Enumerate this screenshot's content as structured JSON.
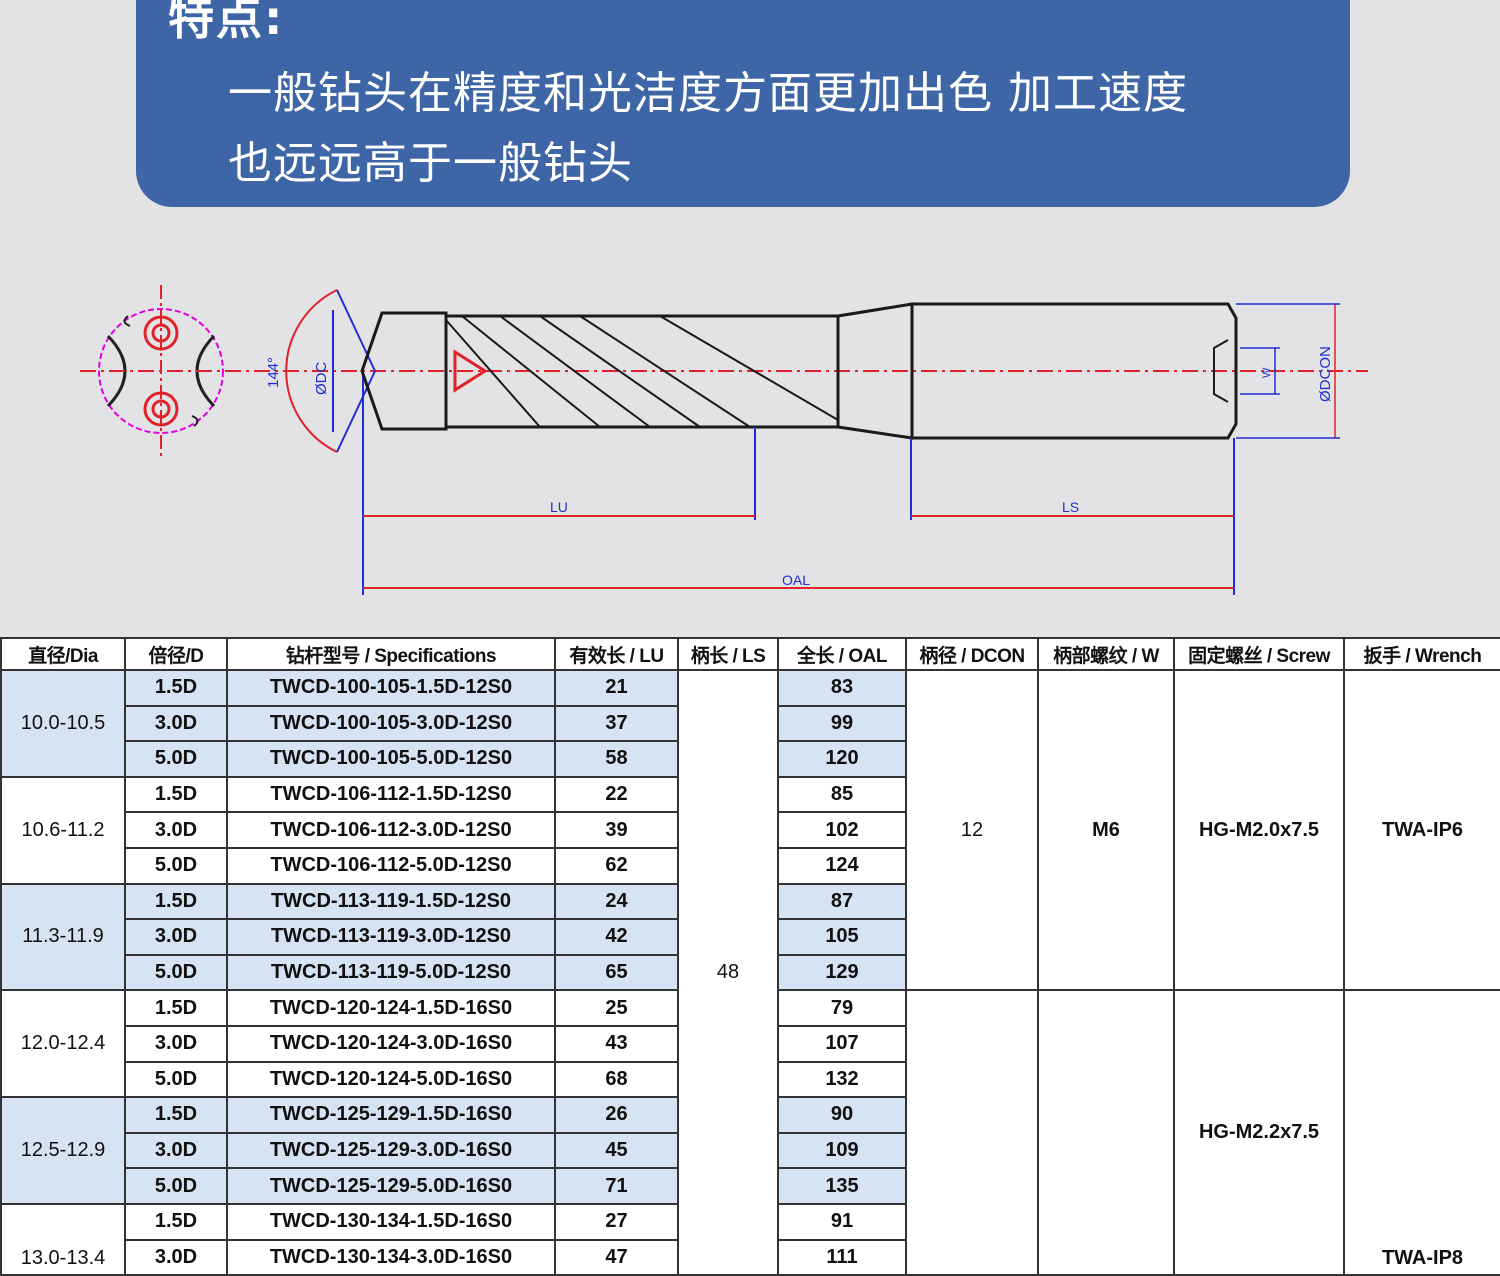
{
  "banner": {
    "title": "特点:",
    "line1": "一般钻头在精度和光洁度方面更加出色 加工速度",
    "line2": "也远远高于一般钻头"
  },
  "drawing": {
    "labels": {
      "angle": "144°",
      "dc": "ØDC",
      "dcon": "ØDCON",
      "lu": "LU",
      "ls": "LS",
      "oal": "OAL",
      "w": "W"
    },
    "colors": {
      "outline": "#1a1a1a",
      "centerline": "#e0222a",
      "dimension": "#2030d0",
      "circle": "#e000e0"
    }
  },
  "table": {
    "headers": [
      "直径/Dia",
      "倍径/D",
      "钻杆型号 / Specifications",
      "有效长 / LU",
      "柄长 / LS",
      "全长 / OAL",
      "柄径 / DCON",
      "柄部螺纹 / W",
      "固定螺丝 / Screw",
      "扳手 / Wrench"
    ],
    "rows": [
      {
        "dia": "10.0-10.5",
        "d": "1.5D",
        "spec": "TWCD-100-105-1.5D-12S0",
        "lu": "21",
        "oal": "83"
      },
      {
        "dia": "10.0-10.5",
        "d": "3.0D",
        "spec": "TWCD-100-105-3.0D-12S0",
        "lu": "37",
        "oal": "99"
      },
      {
        "dia": "10.0-10.5",
        "d": "5.0D",
        "spec": "TWCD-100-105-5.0D-12S0",
        "lu": "58",
        "oal": "120"
      },
      {
        "dia": "10.6-11.2",
        "d": "1.5D",
        "spec": "TWCD-106-112-1.5D-12S0",
        "lu": "22",
        "oal": "85"
      },
      {
        "dia": "10.6-11.2",
        "d": "3.0D",
        "spec": "TWCD-106-112-3.0D-12S0",
        "lu": "39",
        "oal": "102"
      },
      {
        "dia": "10.6-11.2",
        "d": "5.0D",
        "spec": "TWCD-106-112-5.0D-12S0",
        "lu": "62",
        "oal": "124"
      },
      {
        "dia": "11.3-11.9",
        "d": "1.5D",
        "spec": "TWCD-113-119-1.5D-12S0",
        "lu": "24",
        "oal": "87"
      },
      {
        "dia": "11.3-11.9",
        "d": "3.0D",
        "spec": "TWCD-113-119-3.0D-12S0",
        "lu": "42",
        "oal": "105"
      },
      {
        "dia": "11.3-11.9",
        "d": "5.0D",
        "spec": "TWCD-113-119-5.0D-12S0",
        "lu": "65",
        "oal": "129"
      },
      {
        "dia": "12.0-12.4",
        "d": "1.5D",
        "spec": "TWCD-120-124-1.5D-16S0",
        "lu": "25",
        "oal": "79"
      },
      {
        "dia": "12.0-12.4",
        "d": "3.0D",
        "spec": "TWCD-120-124-3.0D-16S0",
        "lu": "43",
        "oal": "107"
      },
      {
        "dia": "12.0-12.4",
        "d": "5.0D",
        "spec": "TWCD-120-124-5.0D-16S0",
        "lu": "68",
        "oal": "132"
      },
      {
        "dia": "12.5-12.9",
        "d": "1.5D",
        "spec": "TWCD-125-129-1.5D-16S0",
        "lu": "26",
        "oal": "90"
      },
      {
        "dia": "12.5-12.9",
        "d": "3.0D",
        "spec": "TWCD-125-129-3.0D-16S0",
        "lu": "45",
        "oal": "109"
      },
      {
        "dia": "12.5-12.9",
        "d": "5.0D",
        "spec": "TWCD-125-129-5.0D-16S0",
        "lu": "71",
        "oal": "135"
      },
      {
        "dia": "13.0-13.4",
        "d": "1.5D",
        "spec": "TWCD-130-134-1.5D-16S0",
        "lu": "27",
        "oal": "91"
      },
      {
        "dia": "13.0-13.4",
        "d": "3.0D",
        "spec": "TWCD-130-134-3.0D-16S0",
        "lu": "47",
        "oal": "111"
      }
    ],
    "ls": "48",
    "group12": {
      "dcon": "12",
      "w": "M6",
      "screw": "HG-M2.0x7.5",
      "wrench": "TWA-IP6"
    },
    "group16": {
      "screw": "HG-M2.2x7.5",
      "wrench": "TWA-IP8"
    }
  }
}
